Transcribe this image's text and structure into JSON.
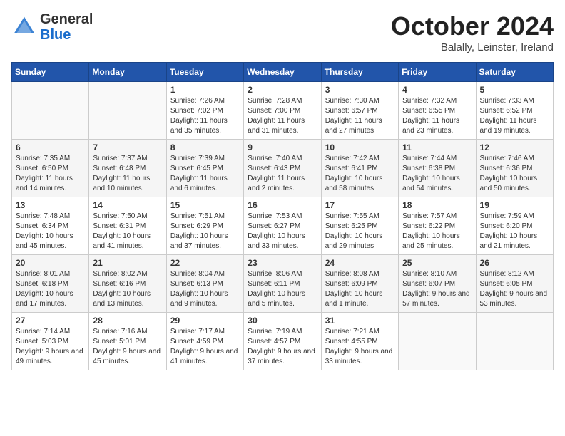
{
  "header": {
    "logo_general": "General",
    "logo_blue": "Blue",
    "month": "October 2024",
    "location": "Balally, Leinster, Ireland"
  },
  "days_of_week": [
    "Sunday",
    "Monday",
    "Tuesday",
    "Wednesday",
    "Thursday",
    "Friday",
    "Saturday"
  ],
  "weeks": [
    [
      {
        "day": "",
        "info": ""
      },
      {
        "day": "",
        "info": ""
      },
      {
        "day": "1",
        "info": "Sunrise: 7:26 AM\nSunset: 7:02 PM\nDaylight: 11 hours and 35 minutes."
      },
      {
        "day": "2",
        "info": "Sunrise: 7:28 AM\nSunset: 7:00 PM\nDaylight: 11 hours and 31 minutes."
      },
      {
        "day": "3",
        "info": "Sunrise: 7:30 AM\nSunset: 6:57 PM\nDaylight: 11 hours and 27 minutes."
      },
      {
        "day": "4",
        "info": "Sunrise: 7:32 AM\nSunset: 6:55 PM\nDaylight: 11 hours and 23 minutes."
      },
      {
        "day": "5",
        "info": "Sunrise: 7:33 AM\nSunset: 6:52 PM\nDaylight: 11 hours and 19 minutes."
      }
    ],
    [
      {
        "day": "6",
        "info": "Sunrise: 7:35 AM\nSunset: 6:50 PM\nDaylight: 11 hours and 14 minutes."
      },
      {
        "day": "7",
        "info": "Sunrise: 7:37 AM\nSunset: 6:48 PM\nDaylight: 11 hours and 10 minutes."
      },
      {
        "day": "8",
        "info": "Sunrise: 7:39 AM\nSunset: 6:45 PM\nDaylight: 11 hours and 6 minutes."
      },
      {
        "day": "9",
        "info": "Sunrise: 7:40 AM\nSunset: 6:43 PM\nDaylight: 11 hours and 2 minutes."
      },
      {
        "day": "10",
        "info": "Sunrise: 7:42 AM\nSunset: 6:41 PM\nDaylight: 10 hours and 58 minutes."
      },
      {
        "day": "11",
        "info": "Sunrise: 7:44 AM\nSunset: 6:38 PM\nDaylight: 10 hours and 54 minutes."
      },
      {
        "day": "12",
        "info": "Sunrise: 7:46 AM\nSunset: 6:36 PM\nDaylight: 10 hours and 50 minutes."
      }
    ],
    [
      {
        "day": "13",
        "info": "Sunrise: 7:48 AM\nSunset: 6:34 PM\nDaylight: 10 hours and 45 minutes."
      },
      {
        "day": "14",
        "info": "Sunrise: 7:50 AM\nSunset: 6:31 PM\nDaylight: 10 hours and 41 minutes."
      },
      {
        "day": "15",
        "info": "Sunrise: 7:51 AM\nSunset: 6:29 PM\nDaylight: 10 hours and 37 minutes."
      },
      {
        "day": "16",
        "info": "Sunrise: 7:53 AM\nSunset: 6:27 PM\nDaylight: 10 hours and 33 minutes."
      },
      {
        "day": "17",
        "info": "Sunrise: 7:55 AM\nSunset: 6:25 PM\nDaylight: 10 hours and 29 minutes."
      },
      {
        "day": "18",
        "info": "Sunrise: 7:57 AM\nSunset: 6:22 PM\nDaylight: 10 hours and 25 minutes."
      },
      {
        "day": "19",
        "info": "Sunrise: 7:59 AM\nSunset: 6:20 PM\nDaylight: 10 hours and 21 minutes."
      }
    ],
    [
      {
        "day": "20",
        "info": "Sunrise: 8:01 AM\nSunset: 6:18 PM\nDaylight: 10 hours and 17 minutes."
      },
      {
        "day": "21",
        "info": "Sunrise: 8:02 AM\nSunset: 6:16 PM\nDaylight: 10 hours and 13 minutes."
      },
      {
        "day": "22",
        "info": "Sunrise: 8:04 AM\nSunset: 6:13 PM\nDaylight: 10 hours and 9 minutes."
      },
      {
        "day": "23",
        "info": "Sunrise: 8:06 AM\nSunset: 6:11 PM\nDaylight: 10 hours and 5 minutes."
      },
      {
        "day": "24",
        "info": "Sunrise: 8:08 AM\nSunset: 6:09 PM\nDaylight: 10 hours and 1 minute."
      },
      {
        "day": "25",
        "info": "Sunrise: 8:10 AM\nSunset: 6:07 PM\nDaylight: 9 hours and 57 minutes."
      },
      {
        "day": "26",
        "info": "Sunrise: 8:12 AM\nSunset: 6:05 PM\nDaylight: 9 hours and 53 minutes."
      }
    ],
    [
      {
        "day": "27",
        "info": "Sunrise: 7:14 AM\nSunset: 5:03 PM\nDaylight: 9 hours and 49 minutes."
      },
      {
        "day": "28",
        "info": "Sunrise: 7:16 AM\nSunset: 5:01 PM\nDaylight: 9 hours and 45 minutes."
      },
      {
        "day": "29",
        "info": "Sunrise: 7:17 AM\nSunset: 4:59 PM\nDaylight: 9 hours and 41 minutes."
      },
      {
        "day": "30",
        "info": "Sunrise: 7:19 AM\nSunset: 4:57 PM\nDaylight: 9 hours and 37 minutes."
      },
      {
        "day": "31",
        "info": "Sunrise: 7:21 AM\nSunset: 4:55 PM\nDaylight: 9 hours and 33 minutes."
      },
      {
        "day": "",
        "info": ""
      },
      {
        "day": "",
        "info": ""
      }
    ]
  ]
}
